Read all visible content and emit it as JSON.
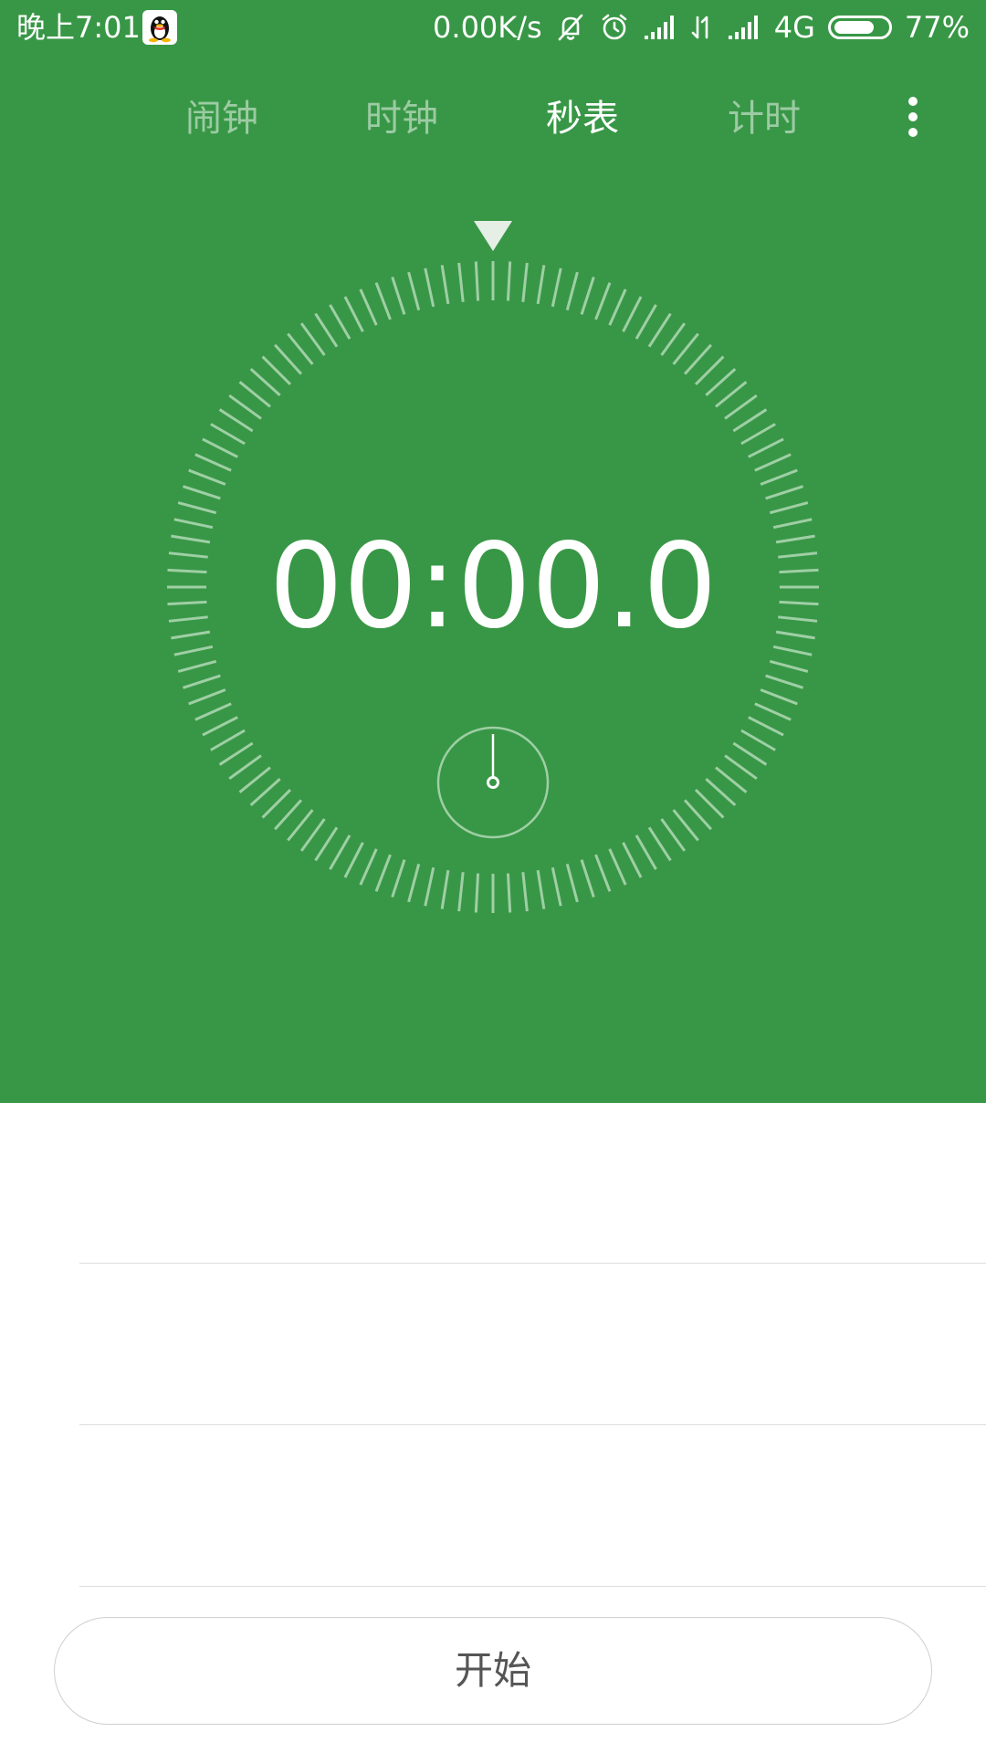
{
  "status_bar": {
    "time": "晚上7:01",
    "net_speed": "0.00K/s",
    "network_type": "4G",
    "battery_percent": "77%",
    "battery_level": 0.77,
    "icons": [
      "qq-icon",
      "mute-bell-icon",
      "alarm-icon",
      "signal-icon",
      "data-arrows-icon",
      "signal-icon",
      "battery-icon"
    ]
  },
  "tabs": [
    {
      "label": "闹钟",
      "active": false
    },
    {
      "label": "时钟",
      "active": false
    },
    {
      "label": "秒表",
      "active": true
    },
    {
      "label": "计时",
      "active": false
    }
  ],
  "stopwatch": {
    "display": "00:00.0"
  },
  "laps": [],
  "start_button": {
    "label": "开始"
  },
  "colors": {
    "primary": "#389746",
    "tick": "#9fcfa5",
    "background": "#ffffff"
  }
}
